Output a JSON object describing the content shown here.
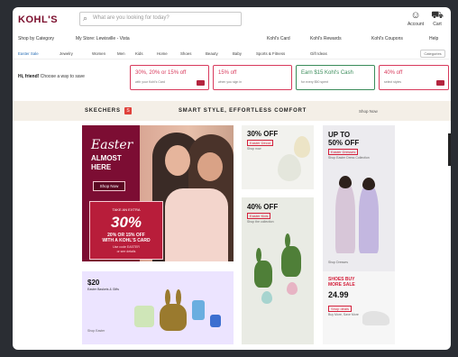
{
  "header": {
    "logo": "KOHL'S",
    "search_placeholder": "What are you looking for today?",
    "icons": [
      {
        "name": "account-icon",
        "glyph": "☺",
        "label": "Account"
      },
      {
        "name": "cart-icon",
        "glyph": "⛟",
        "label": "Cart"
      }
    ]
  },
  "nav": {
    "row1": [
      "Shop by Category",
      "My Store: Lewisville - Vista",
      "Kohl's Card",
      "Kohl's Rewards",
      "Kohl's Coupons",
      "Help"
    ],
    "row2": [
      "Easter Sale",
      "Jewelry",
      "Women",
      "Men",
      "Kids",
      "Home",
      "Shoes",
      "Beauty",
      "Baby",
      "Sports & Fitness",
      "Gift Ideas"
    ],
    "select": "Categories"
  },
  "greeting": {
    "bold": "Hi, friend!",
    "text": "Choose a way to save"
  },
  "offers": [
    {
      "title": "30%, 20% or 15% off",
      "sub": "with your Kohl's Card",
      "color": "#d83a5c"
    },
    {
      "title": "15% off",
      "sub": "when you sign in",
      "color": "#d83a5c"
    },
    {
      "title": "Earn $15 Kohl's Cash",
      "sub": "for every $50 spent",
      "color": "#3a8c5a"
    },
    {
      "title": "40% off",
      "sub": "select styles",
      "color": "#d83a5c"
    }
  ],
  "brand_strip": {
    "brand": "SKECHERS",
    "tagline": "SMART STYLE, EFFORTLESS COMFORT",
    "link": "Shop Now"
  },
  "easter": {
    "script": "Easter",
    "headline": "ALMOST\nHERE",
    "button": "Shop Now",
    "promo_top": "TAKE AN EXTRA",
    "promo_big": "30%",
    "promo_mid": "20% OR 15% OFF\nWITH A KOHL'S CARD",
    "promo_fine": "Use code EASTER\nor see details"
  },
  "tiles": {
    "t30": {
      "big": "30% OFF",
      "red": "Easter Decor",
      "sub": "Shop now"
    },
    "t40": {
      "big": "40% OFF",
      "red": "Easter Kids",
      "sub": "Shop the collection"
    },
    "t50": {
      "big": "UP TO\n50% OFF",
      "red": "Easter Dresses",
      "sub": "Shop Easter Dress Collection",
      "foot": "Shop Dresses"
    },
    "sale": {
      "big": "SHOES BUY\nMORE SALE",
      "price": "24.99",
      "red": "Shop deals",
      "sub": "Buy More, Save More"
    },
    "t20": {
      "big": "$20",
      "sub1": "Easter Baskets & Gifts",
      "sub2": "Shop Easter"
    }
  }
}
